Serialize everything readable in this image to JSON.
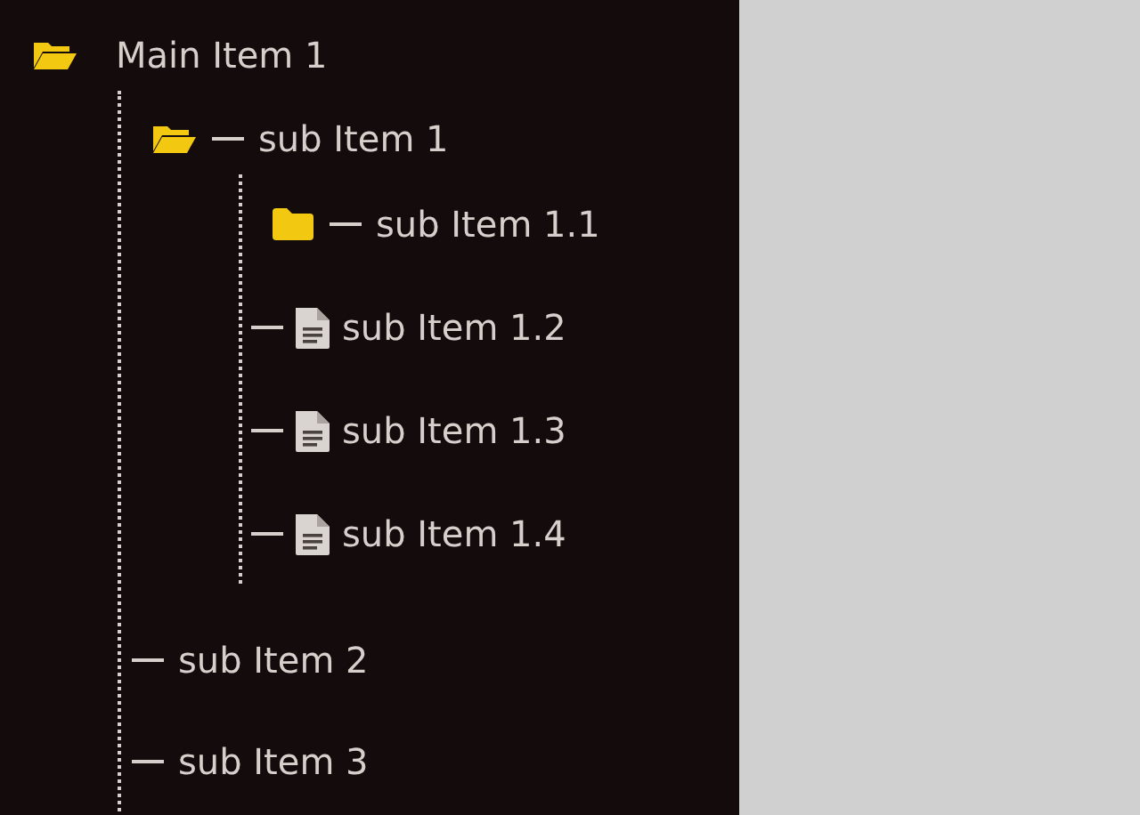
{
  "tree": [
    {
      "label": "Main Item 1",
      "kind": "folder",
      "expanded": true,
      "children": [
        {
          "label": "sub Item 1",
          "kind": "folder",
          "expanded": true,
          "children": [
            {
              "label": "sub Item 1.1",
              "kind": "folder",
              "expanded": false
            },
            {
              "label": "sub Item 1.2",
              "kind": "file"
            },
            {
              "label": "sub Item 1.3",
              "kind": "file"
            },
            {
              "label": "sub Item 1.4",
              "kind": "file"
            }
          ]
        },
        {
          "label": "sub Item 2",
          "kind": "item"
        },
        {
          "label": "sub Item 3",
          "kind": "item"
        }
      ]
    }
  ]
}
